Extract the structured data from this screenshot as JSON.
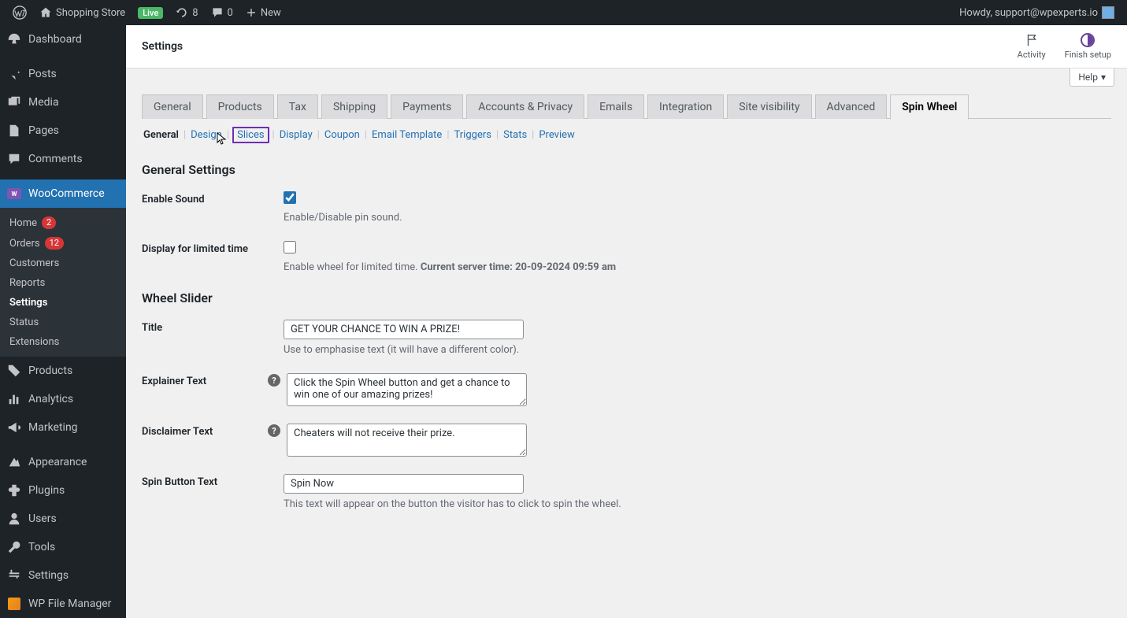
{
  "adminbar": {
    "site_name": "Shopping Store",
    "live": "Live",
    "updates": "8",
    "comments": "0",
    "new": "New",
    "howdy": "Howdy, support@wpexperts.io"
  },
  "sidebar": {
    "dashboard": "Dashboard",
    "posts": "Posts",
    "media": "Media",
    "pages": "Pages",
    "comments": "Comments",
    "woocommerce": "WooCommerce",
    "woo_sub": {
      "home": "Home",
      "home_badge": "2",
      "orders": "Orders",
      "orders_badge": "12",
      "customers": "Customers",
      "reports": "Reports",
      "settings": "Settings",
      "status": "Status",
      "extensions": "Extensions"
    },
    "products": "Products",
    "analytics": "Analytics",
    "marketing": "Marketing",
    "appearance": "Appearance",
    "plugins": "Plugins",
    "users": "Users",
    "tools": "Tools",
    "settings": "Settings",
    "wpfm": "WP File Manager"
  },
  "header": {
    "title": "Settings",
    "activity": "Activity",
    "finish_setup": "Finish setup",
    "help": "Help"
  },
  "tabs": {
    "general": "General",
    "products": "Products",
    "tax": "Tax",
    "shipping": "Shipping",
    "payments": "Payments",
    "accounts": "Accounts & Privacy",
    "emails": "Emails",
    "integration": "Integration",
    "visibility": "Site visibility",
    "advanced": "Advanced",
    "spinwheel": "Spin Wheel"
  },
  "subtabs": {
    "general": "General",
    "design": "Design",
    "slices": "Slices",
    "display": "Display",
    "coupon": "Coupon",
    "email": "Email Template",
    "triggers": "Triggers",
    "stats": "Stats",
    "preview": "Preview"
  },
  "settings": {
    "section1": "General Settings",
    "enable_sound": {
      "label": "Enable Sound",
      "desc": "Enable/Disable pin sound."
    },
    "display_limited": {
      "label": "Display for limited time",
      "desc_pre": "Enable wheel for limited time. ",
      "desc_bold": "Current server time: 20-09-2024 09:59 am"
    },
    "section2": "Wheel Slider",
    "title": {
      "label": "Title",
      "value": "GET YOUR CHANCE TO WIN A PRIZE!",
      "desc": "Use to emphasise text (it will have a different color)."
    },
    "explainer": {
      "label": "Explainer Text",
      "value": "Click the Spin Wheel button and get a chance to win one of our amazing prizes!"
    },
    "disclaimer": {
      "label": "Disclaimer Text",
      "value": "Cheaters will not receive their prize."
    },
    "spin_button": {
      "label": "Spin Button Text",
      "value": "Spin Now",
      "desc": "This text will appear on the button the visitor has to click to spin the wheel."
    }
  }
}
